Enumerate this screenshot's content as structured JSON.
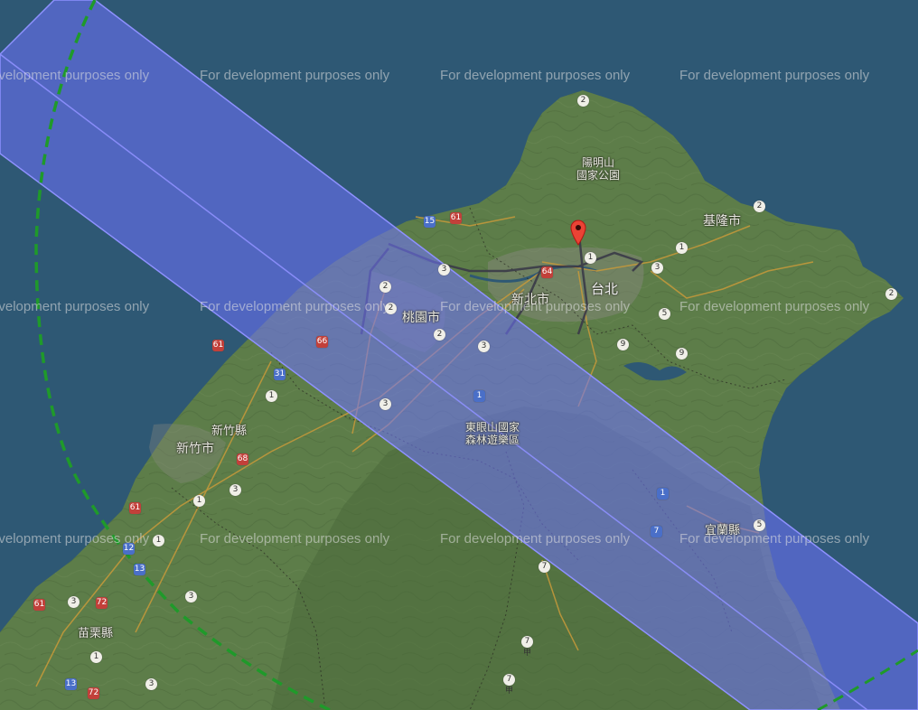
{
  "watermark": {
    "text": "For development purposes only"
  },
  "places": {
    "yangmingshan": [
      "陽明山",
      "國家公園"
    ],
    "keelung": "基隆市",
    "new_taipei": "新北市",
    "taipei": "台北",
    "taoyuan": "桃園市",
    "hsinchu_county": "新竹縣",
    "hsinchu_city": "新竹市",
    "miaoli_county": "苗栗縣",
    "dongyanshan": [
      "東眼山國家",
      "森林遊樂區"
    ],
    "yilan_county": "宜蘭縣"
  },
  "road_shields": [
    "2",
    "2",
    "15",
    "61",
    "64",
    "1",
    "3",
    "5",
    "9",
    "9",
    "2",
    "2",
    "1",
    "61",
    "66",
    "31",
    "1",
    "3",
    "3",
    "68",
    "1",
    "3",
    "61",
    "1",
    "12",
    "13",
    "3",
    "61",
    "3",
    "72",
    "1",
    "13",
    "72",
    "3",
    "1",
    "7",
    "5",
    "7",
    "7甲",
    "7甲",
    "2",
    "1",
    "3",
    "2"
  ],
  "colors": {
    "sea": "#2e5874",
    "land": "#5d7d49",
    "band": "#6f73ff",
    "circle": "#1f9a2a",
    "marker": "#ea4335"
  },
  "marker": {
    "icon": "map-pin-icon"
  }
}
